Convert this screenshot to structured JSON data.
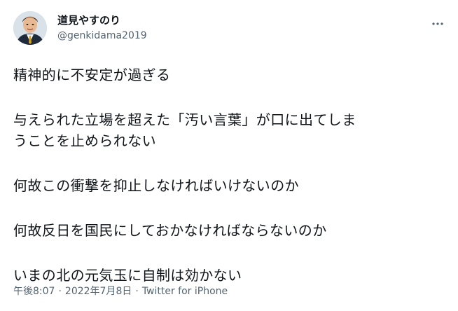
{
  "author": {
    "display_name": "道見やすのり",
    "handle": "@genkidama2019",
    "avatar_icon": "avatar-photo"
  },
  "more_icon": "more-options-icon",
  "tweet": {
    "lines": [
      "精神的に不安定が過ぎる",
      "",
      "与えられた立場を超えた「汚い言葉」が口に出てしま",
      "うことを止められない",
      "",
      "何故この衝撃を抑止しなければいけないのか",
      "",
      "何故反日を国民にしておかなければならないのか",
      "",
      "いまの北の元気玉に自制は効かない"
    ]
  },
  "meta": {
    "time": "午後8:07",
    "separator": "·",
    "date": "2022年7月8日",
    "source": "Twitter for iPhone"
  },
  "colors": {
    "text_primary": "#0f1419",
    "text_secondary": "#536471",
    "background": "#ffffff"
  }
}
